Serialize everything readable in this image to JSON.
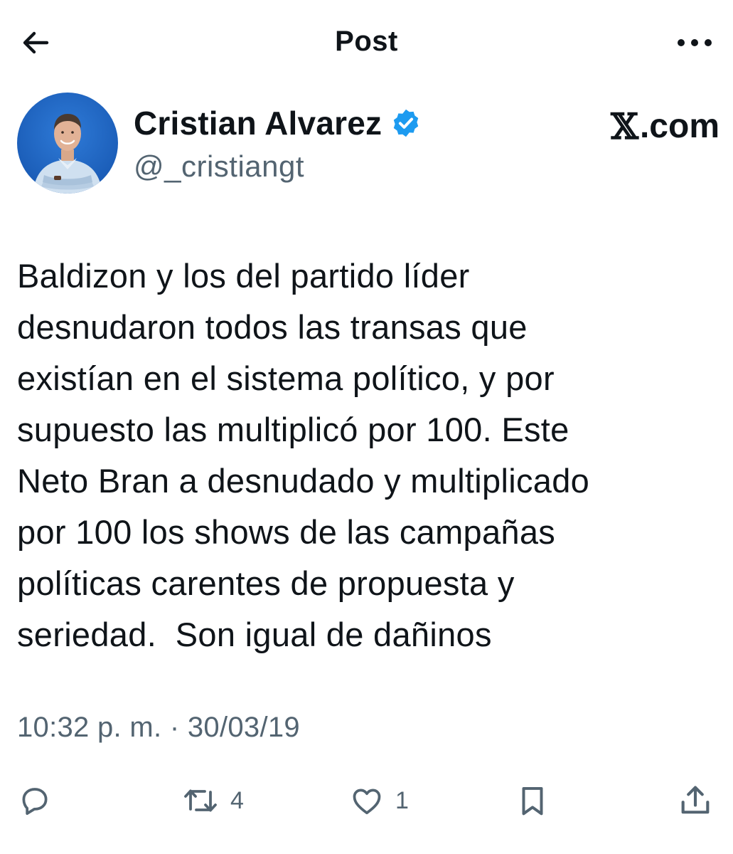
{
  "header": {
    "title": "Post",
    "back_icon": "arrow-left-icon",
    "more_icon": "more-horizontal-icon"
  },
  "author": {
    "display_name": "Cristian Alvarez",
    "handle": "@_cristiangt",
    "verified": true,
    "verified_color": "#1d9bf0",
    "avatar_icon": "avatar-photo"
  },
  "watermark": {
    "glyph": "𝕏",
    "text": ".com"
  },
  "tweet": {
    "text": "Baldizon y los del partido líder\ndesnudaron todos las transas que\nexistían en el sistema político, y por\nsupuesto las multiplicó por 100. Este\nNeto Bran a desnudado y multiplicado\npor 100 los shows de las campañas\npolíticas carentes de propuesta y\nseriedad.  Son igual de dañinos",
    "timestamp": "10:32 p. m. · 30/03/19"
  },
  "actions": {
    "reply_icon": "reply-icon",
    "retweet_icon": "retweet-icon",
    "retweet_count": "4",
    "like_icon": "heart-icon",
    "like_count": "1",
    "bookmark_icon": "bookmark-icon",
    "share_icon": "share-icon"
  },
  "colors": {
    "text_primary": "#0f1419",
    "text_secondary": "#536471",
    "accent": "#1d9bf0"
  }
}
